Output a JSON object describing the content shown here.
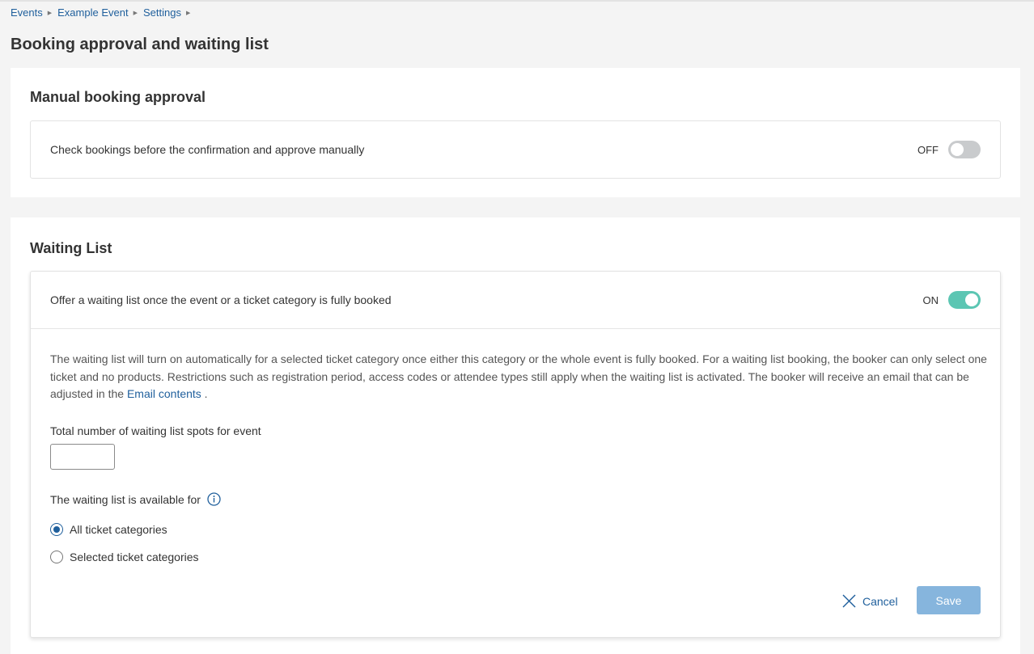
{
  "breadcrumb": {
    "items": [
      "Events",
      "Example Event",
      "Settings"
    ]
  },
  "page_title": "Booking approval and waiting list",
  "manual_approval": {
    "title": "Manual booking approval",
    "row_text": "Check bookings before the confirmation and approve manually",
    "toggle_state": "OFF"
  },
  "waiting_list": {
    "title": "Waiting List",
    "row_text": "Offer a waiting list once the event or a ticket category is fully booked",
    "toggle_state": "ON",
    "description": "The waiting list will turn on automatically for a selected ticket category once either this category or the whole event is fully booked. For a waiting list booking, the booker can only select one ticket and no products. Restrictions such as registration period, access codes or attendee types still apply when the waiting list is activated. The booker will receive an email that can be adjusted in the ",
    "description_link": "Email contents",
    "description_end": " .",
    "spots_label": "Total number of waiting list spots for event",
    "spots_value": "",
    "spots_placeholder": "",
    "available_label": "The waiting list is available for",
    "options": [
      "All ticket categories",
      "Selected ticket categories"
    ],
    "selected_option": "All ticket categories",
    "cancel_label": "Cancel",
    "save_label": "Save"
  },
  "colors": {
    "link": "#1f5f9c",
    "toggle_on": "#5cc6b3",
    "toggle_off": "#c9cbcd",
    "save_button": "#86b5dd",
    "background": "#f4f4f4"
  },
  "icons": [
    "breadcrumb-arrow-icon",
    "info-icon",
    "close-icon"
  ]
}
